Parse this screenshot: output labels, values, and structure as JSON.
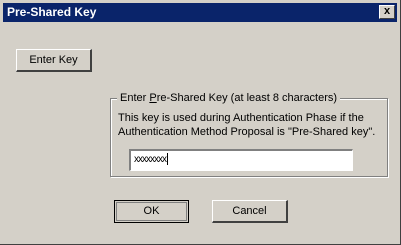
{
  "window": {
    "title": "Pre-Shared Key",
    "close_glyph": "x"
  },
  "enter_key_button": {
    "label": "Enter Key"
  },
  "groupbox": {
    "label_prefix": "Enter ",
    "label_accel": "P",
    "label_suffix": "re-Shared Key (at least 8 characters)",
    "description": "This key is used during Authentication Phase if the Authentication Method Proposal is \"Pre-Shared key\"."
  },
  "key_input": {
    "value": "xxxxxxxx"
  },
  "buttons": {
    "ok": "OK",
    "cancel": "Cancel"
  }
}
